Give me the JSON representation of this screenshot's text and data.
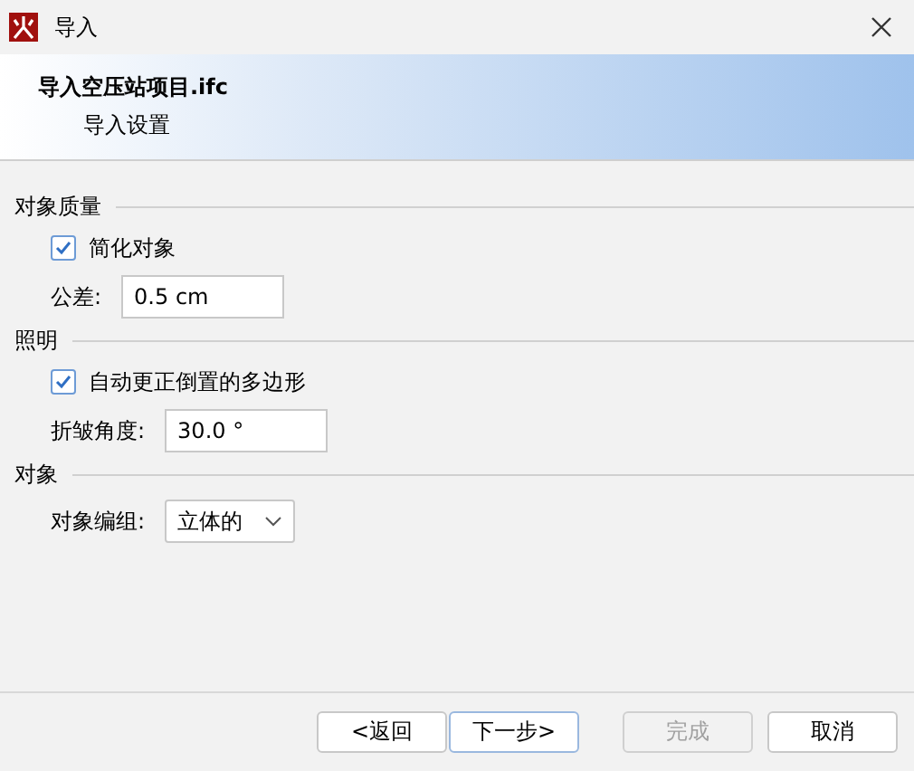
{
  "window": {
    "title": "导入"
  },
  "header": {
    "title": "导入空压站项目.ifc",
    "subtitle": "导入设置"
  },
  "sections": [
    {
      "title": "对象质量",
      "items": [
        {
          "kind": "checkbox",
          "label": "简化对象",
          "checked": true
        },
        {
          "kind": "field",
          "label": "公差:",
          "value": "0.5 cm"
        }
      ]
    },
    {
      "title": "照明",
      "items": [
        {
          "kind": "checkbox",
          "label": "自动更正倒置的多边形",
          "checked": true
        },
        {
          "kind": "field",
          "label": "折皱角度:",
          "value": "30.0 °"
        }
      ]
    },
    {
      "title": "对象",
      "items": [
        {
          "kind": "dropdown",
          "label": "对象编组:",
          "value": "立体的"
        }
      ]
    }
  ],
  "buttons": [
    {
      "label": "<返回",
      "disabled": false,
      "default": false
    },
    {
      "label": "下一步>",
      "disabled": false,
      "default": true
    },
    {
      "label": "完成",
      "disabled": true,
      "default": false
    },
    {
      "label": "取消",
      "disabled": false,
      "default": false
    }
  ]
}
